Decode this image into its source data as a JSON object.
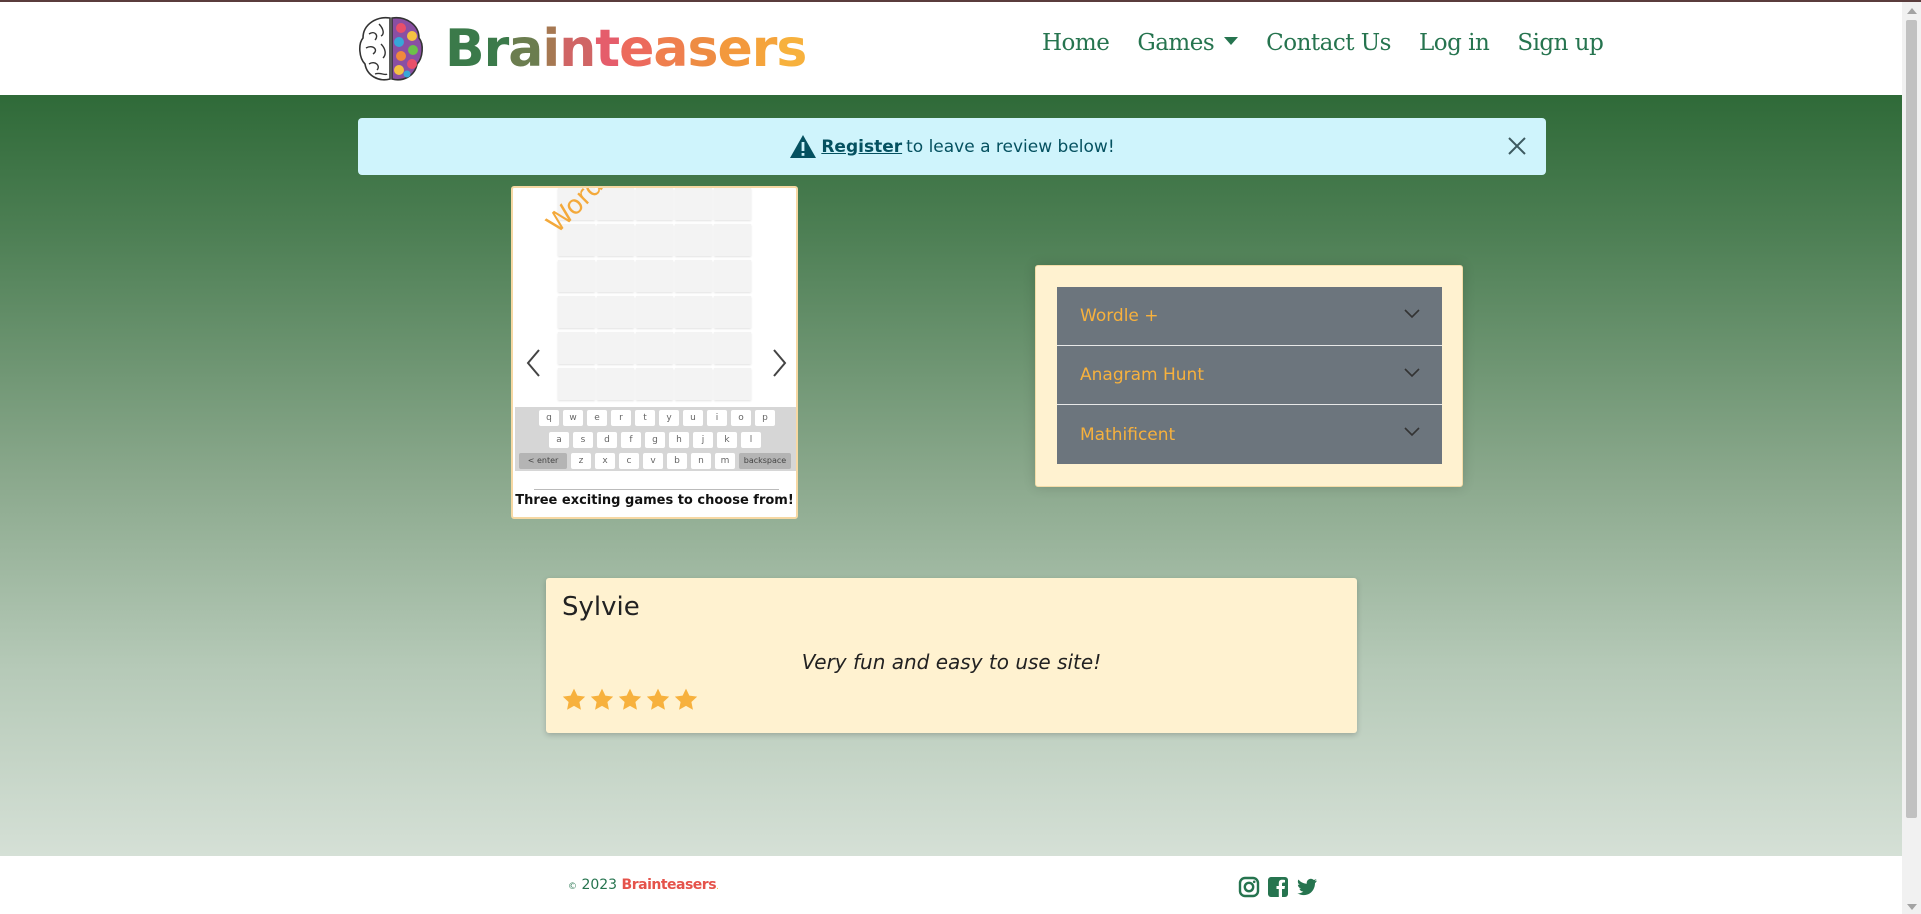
{
  "brand": {
    "name": "Brainteasers",
    "letters": [
      "B",
      "r",
      "a",
      "i",
      "n",
      "t",
      "e",
      "a",
      "s",
      "e",
      "r",
      "s"
    ],
    "colors": [
      "#3b7a4a",
      "#3b7a4a",
      "#6b7d4f",
      "#a67852",
      "#d06565",
      "#e55d6b",
      "#ec6a5c",
      "#ef7f4e",
      "#ee8c43",
      "#f3993d",
      "#f5a43c",
      "#f7b13d"
    ]
  },
  "nav": {
    "home": "Home",
    "games": "Games",
    "contact": "Contact Us",
    "login": "Log in",
    "signup": "Sign up"
  },
  "alert": {
    "link": "Register",
    "text": "to leave a review below!"
  },
  "carousel": {
    "label": "Wordle+",
    "caption": "Three exciting games to choose from!",
    "keyboard_rows": [
      [
        "q",
        "w",
        "e",
        "r",
        "t",
        "y",
        "u",
        "i",
        "o",
        "p"
      ],
      [
        "a",
        "s",
        "d",
        "f",
        "g",
        "h",
        "j",
        "k",
        "l"
      ],
      [
        "< enter",
        "z",
        "x",
        "c",
        "v",
        "b",
        "n",
        "m",
        "backspace"
      ]
    ]
  },
  "accordion": {
    "items": [
      "Wordle +",
      "Anagram Hunt",
      "Mathificent"
    ]
  },
  "review": {
    "name": "Sylvie",
    "text": "Very fun and easy to use site!",
    "rating": 5,
    "star_color": "#f7b13d"
  },
  "footer": {
    "symbol": "©",
    "year": "2023",
    "brand": "Brainteasers",
    "dot": ".",
    "icons": [
      "instagram-icon",
      "facebook-icon",
      "twitter-icon"
    ]
  },
  "colors": {
    "nav_green": "#26744f",
    "accent_orange": "#f7b13d",
    "alert_bg": "#cff4fc",
    "card_cream": "#fff2d0",
    "accordion_gray": "#6c757d"
  }
}
